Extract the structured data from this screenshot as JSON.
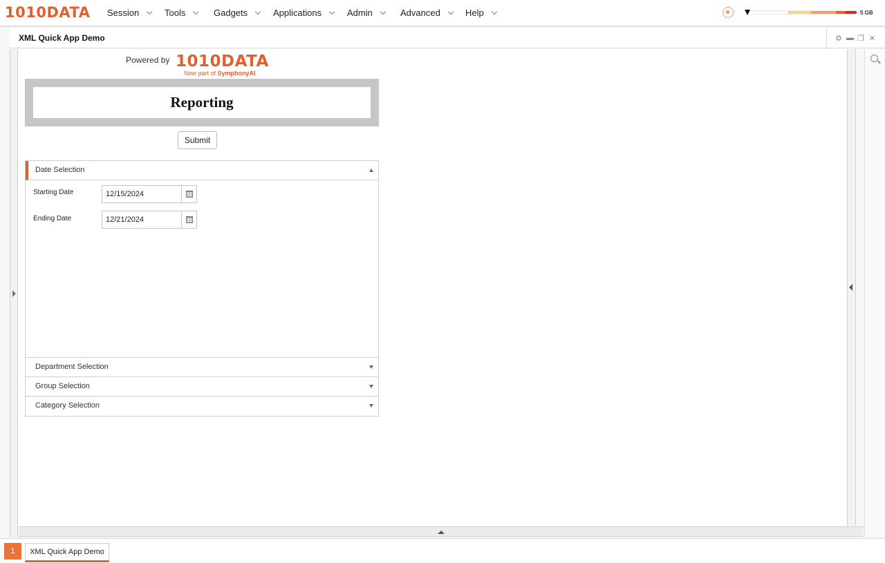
{
  "app": {
    "logo": "1010DATA",
    "nav": [
      {
        "label": "Session"
      },
      {
        "label": "Tools"
      },
      {
        "label": "Gadgets"
      },
      {
        "label": "Applications"
      },
      {
        "label": "Admin"
      },
      {
        "label": "Advanced"
      },
      {
        "label": "Help"
      }
    ],
    "memory": {
      "label": "5 GB",
      "colors": [
        "#f3d98a",
        "#f0a070",
        "#e0602f",
        "#d8262b"
      ]
    },
    "accent_color": "#e0602f"
  },
  "window": {
    "title": "XML Quick App Demo",
    "controls": {
      "settings_icon": "gear-icon",
      "minimize_icon": "minimize-icon",
      "restore_icon": "restore-icon",
      "close_icon": "close-icon"
    }
  },
  "quickapp": {
    "powered_by": "Powered by",
    "brand_logo": "1010DATA",
    "brand_sub_prefix": "Now part of",
    "brand_sub_name": "SymphonyAI",
    "title": "Reporting",
    "submit_label": "Submit",
    "sections": [
      {
        "label": "Date Selection",
        "expanded": true,
        "fields": [
          {
            "label": "Starting Date",
            "value": "12/15/2024"
          },
          {
            "label": "Ending Date",
            "value": "12/21/2024"
          }
        ]
      },
      {
        "label": "Department Selection",
        "expanded": false
      },
      {
        "label": "Group Selection",
        "expanded": false
      },
      {
        "label": "Category Selection",
        "expanded": false
      }
    ]
  },
  "taskbar": {
    "number": "1",
    "tab_label": "XML Quick App Demo"
  }
}
